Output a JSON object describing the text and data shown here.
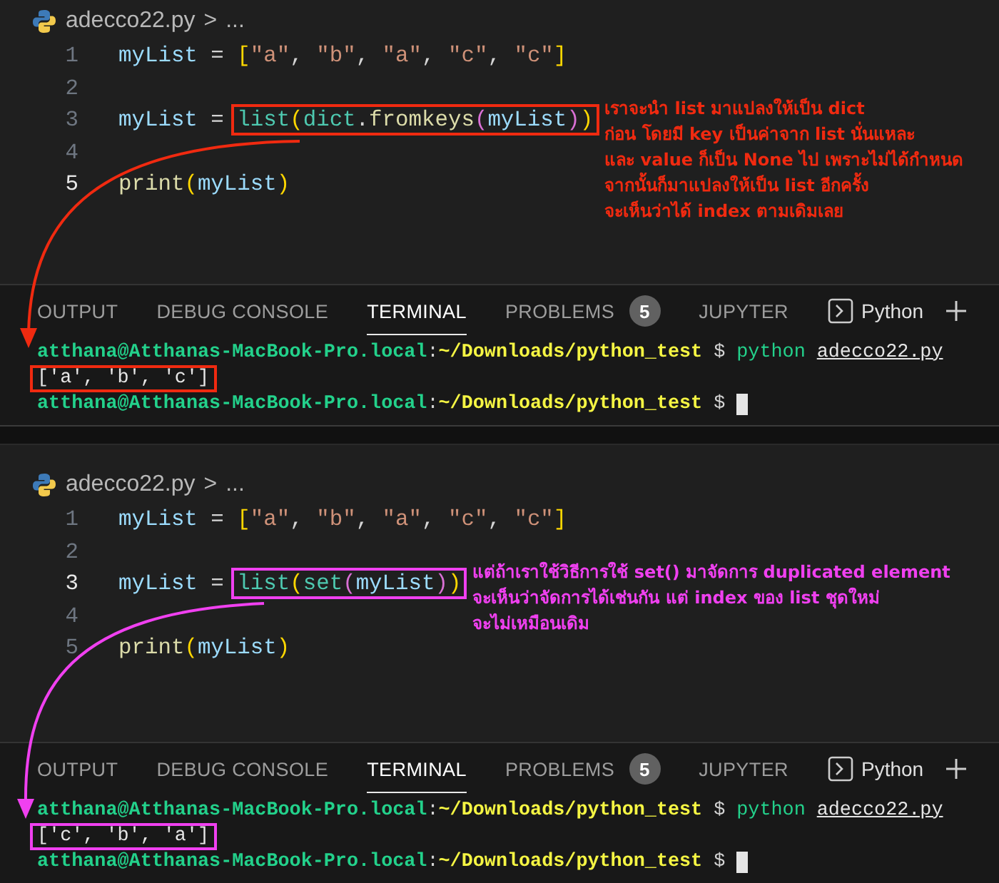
{
  "panels": [
    {
      "breadcrumb": {
        "file": "adecco22.py",
        "separator": ">",
        "more": "..."
      },
      "lines": [
        {
          "number": "1",
          "current": false,
          "tokens": [
            {
              "kind": "var",
              "text": "myList"
            },
            {
              "kind": "op",
              "text": " = "
            },
            {
              "kind": "bracket",
              "text": "["
            },
            {
              "kind": "str",
              "text": "\"a\""
            },
            {
              "kind": "op",
              "text": ", "
            },
            {
              "kind": "str",
              "text": "\"b\""
            },
            {
              "kind": "op",
              "text": ", "
            },
            {
              "kind": "str",
              "text": "\"a\""
            },
            {
              "kind": "op",
              "text": ", "
            },
            {
              "kind": "str",
              "text": "\"c\""
            },
            {
              "kind": "op",
              "text": ", "
            },
            {
              "kind": "str",
              "text": "\"c\""
            },
            {
              "kind": "bracket",
              "text": "]"
            }
          ]
        },
        {
          "number": "2",
          "current": false
        },
        {
          "number": "3",
          "current": false,
          "tokens": [
            {
              "kind": "var",
              "text": "myList"
            },
            {
              "kind": "op",
              "text": " = "
            }
          ],
          "callout": [
            {
              "kind": "type",
              "text": "list"
            },
            {
              "kind": "bracket",
              "text": "("
            },
            {
              "kind": "type",
              "text": "dict"
            },
            {
              "kind": "op",
              "text": "."
            },
            {
              "kind": "fn",
              "text": "fromkeys"
            },
            {
              "kind": "paren",
              "text": "("
            },
            {
              "kind": "var",
              "text": "myList"
            },
            {
              "kind": "paren",
              "text": ")"
            },
            {
              "kind": "bracket",
              "text": ")"
            }
          ]
        },
        {
          "number": "4",
          "current": false
        },
        {
          "number": "5",
          "current": true,
          "tokens": [
            {
              "kind": "fn",
              "text": "print"
            },
            {
              "kind": "bracket",
              "text": "("
            },
            {
              "kind": "var",
              "text": "myList"
            },
            {
              "kind": "bracket",
              "text": ")"
            }
          ]
        }
      ],
      "annotation": {
        "color": "#f02a10",
        "lines": [
          "เราจะนำ list มาแปลงให้เป็น dict",
          "ก่อน โดยมี key เป็นค่าจาก list นั่นแหละ",
          "และ value ก็เป็น None ไป เพราะไม่ได้กำหนด",
          "จากนั้นก็มาแปลงให้เป็น  list อีกครั้ง",
          "จะเห็นว่าได้ index ตามเดิมเลย"
        ]
      },
      "tabs": [
        {
          "label": "OUTPUT",
          "selected": false
        },
        {
          "label": "DEBUG CONSOLE",
          "selected": false
        },
        {
          "label": "TERMINAL",
          "selected": true
        },
        {
          "label": "PROBLEMS",
          "selected": false,
          "badge": "5"
        },
        {
          "label": "JUPYTER",
          "selected": false
        }
      ],
      "shell": "Python",
      "terminal": [
        {
          "kind": "prompt",
          "user": "atthana@Atthanas-MacBook-Pro.local",
          "colon": ":",
          "path": "~/Downloads/python_test",
          "dollar": "$",
          "command": "python",
          "file": "adecco22.py"
        },
        {
          "kind": "output",
          "text": "['a', 'b', 'c']"
        },
        {
          "kind": "prompt",
          "user": "atthana@Atthanas-MacBook-Pro.local",
          "colon": ":",
          "path": "~/Downloads/python_test",
          "dollar": "$",
          "cursor": true
        }
      ]
    },
    {
      "breadcrumb": {
        "file": "adecco22.py",
        "separator": ">",
        "more": "..."
      },
      "lines": [
        {
          "number": "1",
          "current": false,
          "tokens": [
            {
              "kind": "var",
              "text": "myList"
            },
            {
              "kind": "op",
              "text": " = "
            },
            {
              "kind": "bracket",
              "text": "["
            },
            {
              "kind": "str",
              "text": "\"a\""
            },
            {
              "kind": "op",
              "text": ", "
            },
            {
              "kind": "str",
              "text": "\"b\""
            },
            {
              "kind": "op",
              "text": ", "
            },
            {
              "kind": "str",
              "text": "\"a\""
            },
            {
              "kind": "op",
              "text": ", "
            },
            {
              "kind": "str",
              "text": "\"c\""
            },
            {
              "kind": "op",
              "text": ", "
            },
            {
              "kind": "str",
              "text": "\"c\""
            },
            {
              "kind": "bracket",
              "text": "]"
            }
          ]
        },
        {
          "number": "2",
          "current": false
        },
        {
          "number": "3",
          "current": true,
          "tokens": [
            {
              "kind": "var",
              "text": "myList"
            },
            {
              "kind": "op",
              "text": " = "
            }
          ],
          "callout": [
            {
              "kind": "type",
              "text": "list"
            },
            {
              "kind": "bracket",
              "text": "("
            },
            {
              "kind": "type",
              "text": "set"
            },
            {
              "kind": "paren",
              "text": "("
            },
            {
              "kind": "var",
              "text": "myList"
            },
            {
              "kind": "paren",
              "text": ")"
            },
            {
              "kind": "bracket",
              "text": ")"
            }
          ]
        },
        {
          "number": "4",
          "current": false
        },
        {
          "number": "5",
          "current": false,
          "tokens": [
            {
              "kind": "fn",
              "text": "print"
            },
            {
              "kind": "bracket",
              "text": "("
            },
            {
              "kind": "var",
              "text": "myList"
            },
            {
              "kind": "bracket",
              "text": ")"
            }
          ]
        }
      ],
      "annotation": {
        "color": "#f040f0",
        "lines": [
          "แต่ถ้าเราใช้วิธีการใช้ set() มาจัดการ duplicated element",
          "จะเห็นว่าจัดการได้เช่นกัน แต่ index ของ list ชุดใหม่",
          "จะไม่เหมือนเดิม"
        ]
      },
      "tabs": [
        {
          "label": "OUTPUT",
          "selected": false
        },
        {
          "label": "DEBUG CONSOLE",
          "selected": false
        },
        {
          "label": "TERMINAL",
          "selected": true
        },
        {
          "label": "PROBLEMS",
          "selected": false,
          "badge": "5"
        },
        {
          "label": "JUPYTER",
          "selected": false
        }
      ],
      "shell": "Python",
      "terminal": [
        {
          "kind": "prompt",
          "user": "atthana@Atthanas-MacBook-Pro.local",
          "colon": ":",
          "path": "~/Downloads/python_test",
          "dollar": "$",
          "command": "python",
          "file": "adecco22.py"
        },
        {
          "kind": "output",
          "text": "['c', 'b', 'a']"
        },
        {
          "kind": "prompt",
          "user": "atthana@Atthanas-MacBook-Pro.local",
          "colon": ":",
          "path": "~/Downloads/python_test",
          "dollar": "$",
          "cursor": true
        }
      ]
    }
  ]
}
